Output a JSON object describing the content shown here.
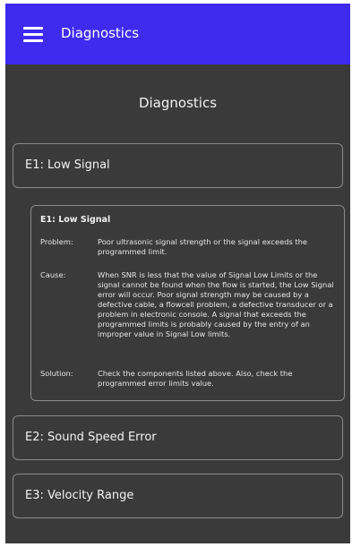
{
  "appbar": {
    "title": "Diagnostics",
    "menu_icon": "hamburger-menu-icon",
    "color": "#3f2bf0"
  },
  "page": {
    "title": "Diagnostics"
  },
  "errors": [
    {
      "title": "E1: Low Signal"
    },
    {
      "title": "E2: Sound Speed Error"
    },
    {
      "title": "E3: Velocity Range"
    }
  ],
  "detail": {
    "title": "E1: Low Signal",
    "problem_label": "Problem:",
    "problem": "Poor ultrasonic signal strength or the signal exceeds the programmed limit.",
    "cause_label": "Cause:",
    "cause": "When SNR is less that the value of Signal Low Limits or the signal cannot be found when the flow is started, the Low Signal error will occur. Poor signal strength may be caused by a defective cable, a flowcell problem, a defective transducer or a problem in electronic console. A signal that exceeds the programmed limits is probably caused by the entry of an improper value in Signal Low limits.",
    "solution_label": "Solution:",
    "solution": "Check the components listed above. Also, check the programmed error limits value."
  }
}
